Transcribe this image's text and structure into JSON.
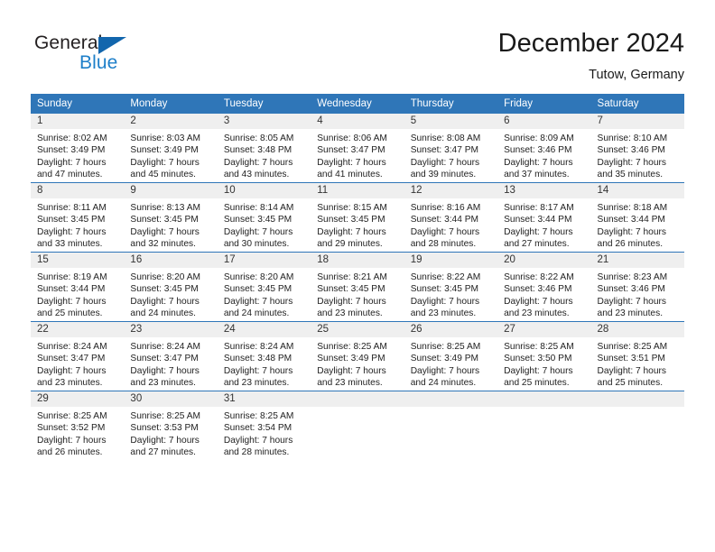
{
  "brand": {
    "name_part1": "General",
    "name_part2": "Blue",
    "triangle_icon": "triangle-icon",
    "color_dark": "#231f20",
    "color_blue": "#1e7fc9"
  },
  "header": {
    "title": "December 2024",
    "location": "Tutow, Germany"
  },
  "colors": {
    "header_blue": "#2f76b8",
    "daynum_band": "#efefef",
    "text": "#222222"
  },
  "weekday_headers": [
    "Sunday",
    "Monday",
    "Tuesday",
    "Wednesday",
    "Thursday",
    "Friday",
    "Saturday"
  ],
  "labels": {
    "sunrise_prefix": "Sunrise:",
    "sunset_prefix": "Sunset:",
    "daylight_prefix": "Daylight:"
  },
  "weeks": [
    [
      {
        "day": "1",
        "sunrise": "Sunrise: 8:02 AM",
        "sunset": "Sunset: 3:49 PM",
        "daylight_line1": "Daylight: 7 hours",
        "daylight_line2": "and 47 minutes."
      },
      {
        "day": "2",
        "sunrise": "Sunrise: 8:03 AM",
        "sunset": "Sunset: 3:49 PM",
        "daylight_line1": "Daylight: 7 hours",
        "daylight_line2": "and 45 minutes."
      },
      {
        "day": "3",
        "sunrise": "Sunrise: 8:05 AM",
        "sunset": "Sunset: 3:48 PM",
        "daylight_line1": "Daylight: 7 hours",
        "daylight_line2": "and 43 minutes."
      },
      {
        "day": "4",
        "sunrise": "Sunrise: 8:06 AM",
        "sunset": "Sunset: 3:47 PM",
        "daylight_line1": "Daylight: 7 hours",
        "daylight_line2": "and 41 minutes."
      },
      {
        "day": "5",
        "sunrise": "Sunrise: 8:08 AM",
        "sunset": "Sunset: 3:47 PM",
        "daylight_line1": "Daylight: 7 hours",
        "daylight_line2": "and 39 minutes."
      },
      {
        "day": "6",
        "sunrise": "Sunrise: 8:09 AM",
        "sunset": "Sunset: 3:46 PM",
        "daylight_line1": "Daylight: 7 hours",
        "daylight_line2": "and 37 minutes."
      },
      {
        "day": "7",
        "sunrise": "Sunrise: 8:10 AM",
        "sunset": "Sunset: 3:46 PM",
        "daylight_line1": "Daylight: 7 hours",
        "daylight_line2": "and 35 minutes."
      }
    ],
    [
      {
        "day": "8",
        "sunrise": "Sunrise: 8:11 AM",
        "sunset": "Sunset: 3:45 PM",
        "daylight_line1": "Daylight: 7 hours",
        "daylight_line2": "and 33 minutes."
      },
      {
        "day": "9",
        "sunrise": "Sunrise: 8:13 AM",
        "sunset": "Sunset: 3:45 PM",
        "daylight_line1": "Daylight: 7 hours",
        "daylight_line2": "and 32 minutes."
      },
      {
        "day": "10",
        "sunrise": "Sunrise: 8:14 AM",
        "sunset": "Sunset: 3:45 PM",
        "daylight_line1": "Daylight: 7 hours",
        "daylight_line2": "and 30 minutes."
      },
      {
        "day": "11",
        "sunrise": "Sunrise: 8:15 AM",
        "sunset": "Sunset: 3:45 PM",
        "daylight_line1": "Daylight: 7 hours",
        "daylight_line2": "and 29 minutes."
      },
      {
        "day": "12",
        "sunrise": "Sunrise: 8:16 AM",
        "sunset": "Sunset: 3:44 PM",
        "daylight_line1": "Daylight: 7 hours",
        "daylight_line2": "and 28 minutes."
      },
      {
        "day": "13",
        "sunrise": "Sunrise: 8:17 AM",
        "sunset": "Sunset: 3:44 PM",
        "daylight_line1": "Daylight: 7 hours",
        "daylight_line2": "and 27 minutes."
      },
      {
        "day": "14",
        "sunrise": "Sunrise: 8:18 AM",
        "sunset": "Sunset: 3:44 PM",
        "daylight_line1": "Daylight: 7 hours",
        "daylight_line2": "and 26 minutes."
      }
    ],
    [
      {
        "day": "15",
        "sunrise": "Sunrise: 8:19 AM",
        "sunset": "Sunset: 3:44 PM",
        "daylight_line1": "Daylight: 7 hours",
        "daylight_line2": "and 25 minutes."
      },
      {
        "day": "16",
        "sunrise": "Sunrise: 8:20 AM",
        "sunset": "Sunset: 3:45 PM",
        "daylight_line1": "Daylight: 7 hours",
        "daylight_line2": "and 24 minutes."
      },
      {
        "day": "17",
        "sunrise": "Sunrise: 8:20 AM",
        "sunset": "Sunset: 3:45 PM",
        "daylight_line1": "Daylight: 7 hours",
        "daylight_line2": "and 24 minutes."
      },
      {
        "day": "18",
        "sunrise": "Sunrise: 8:21 AM",
        "sunset": "Sunset: 3:45 PM",
        "daylight_line1": "Daylight: 7 hours",
        "daylight_line2": "and 23 minutes."
      },
      {
        "day": "19",
        "sunrise": "Sunrise: 8:22 AM",
        "sunset": "Sunset: 3:45 PM",
        "daylight_line1": "Daylight: 7 hours",
        "daylight_line2": "and 23 minutes."
      },
      {
        "day": "20",
        "sunrise": "Sunrise: 8:22 AM",
        "sunset": "Sunset: 3:46 PM",
        "daylight_line1": "Daylight: 7 hours",
        "daylight_line2": "and 23 minutes."
      },
      {
        "day": "21",
        "sunrise": "Sunrise: 8:23 AM",
        "sunset": "Sunset: 3:46 PM",
        "daylight_line1": "Daylight: 7 hours",
        "daylight_line2": "and 23 minutes."
      }
    ],
    [
      {
        "day": "22",
        "sunrise": "Sunrise: 8:24 AM",
        "sunset": "Sunset: 3:47 PM",
        "daylight_line1": "Daylight: 7 hours",
        "daylight_line2": "and 23 minutes."
      },
      {
        "day": "23",
        "sunrise": "Sunrise: 8:24 AM",
        "sunset": "Sunset: 3:47 PM",
        "daylight_line1": "Daylight: 7 hours",
        "daylight_line2": "and 23 minutes."
      },
      {
        "day": "24",
        "sunrise": "Sunrise: 8:24 AM",
        "sunset": "Sunset: 3:48 PM",
        "daylight_line1": "Daylight: 7 hours",
        "daylight_line2": "and 23 minutes."
      },
      {
        "day": "25",
        "sunrise": "Sunrise: 8:25 AM",
        "sunset": "Sunset: 3:49 PM",
        "daylight_line1": "Daylight: 7 hours",
        "daylight_line2": "and 23 minutes."
      },
      {
        "day": "26",
        "sunrise": "Sunrise: 8:25 AM",
        "sunset": "Sunset: 3:49 PM",
        "daylight_line1": "Daylight: 7 hours",
        "daylight_line2": "and 24 minutes."
      },
      {
        "day": "27",
        "sunrise": "Sunrise: 8:25 AM",
        "sunset": "Sunset: 3:50 PM",
        "daylight_line1": "Daylight: 7 hours",
        "daylight_line2": "and 25 minutes."
      },
      {
        "day": "28",
        "sunrise": "Sunrise: 8:25 AM",
        "sunset": "Sunset: 3:51 PM",
        "daylight_line1": "Daylight: 7 hours",
        "daylight_line2": "and 25 minutes."
      }
    ],
    [
      {
        "day": "29",
        "sunrise": "Sunrise: 8:25 AM",
        "sunset": "Sunset: 3:52 PM",
        "daylight_line1": "Daylight: 7 hours",
        "daylight_line2": "and 26 minutes."
      },
      {
        "day": "30",
        "sunrise": "Sunrise: 8:25 AM",
        "sunset": "Sunset: 3:53 PM",
        "daylight_line1": "Daylight: 7 hours",
        "daylight_line2": "and 27 minutes."
      },
      {
        "day": "31",
        "sunrise": "Sunrise: 8:25 AM",
        "sunset": "Sunset: 3:54 PM",
        "daylight_line1": "Daylight: 7 hours",
        "daylight_line2": "and 28 minutes."
      },
      {
        "day": "",
        "sunrise": "",
        "sunset": "",
        "daylight_line1": "",
        "daylight_line2": ""
      },
      {
        "day": "",
        "sunrise": "",
        "sunset": "",
        "daylight_line1": "",
        "daylight_line2": ""
      },
      {
        "day": "",
        "sunrise": "",
        "sunset": "",
        "daylight_line1": "",
        "daylight_line2": ""
      },
      {
        "day": "",
        "sunrise": "",
        "sunset": "",
        "daylight_line1": "",
        "daylight_line2": ""
      }
    ]
  ]
}
